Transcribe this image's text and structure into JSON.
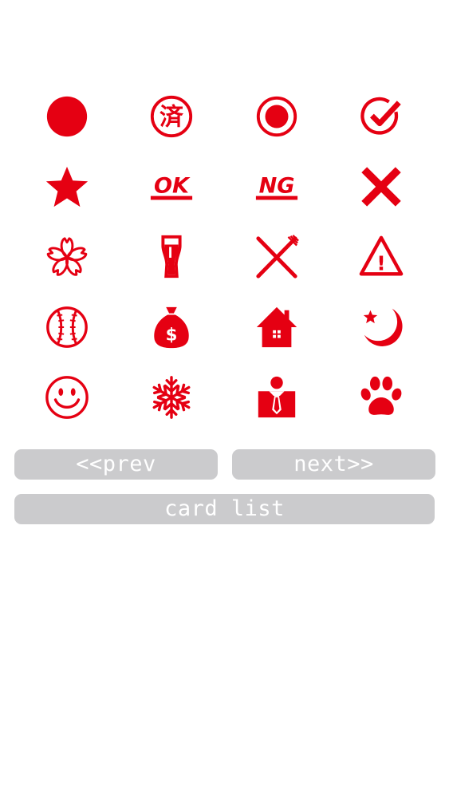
{
  "colors": {
    "stamp": "#e50012",
    "button_bg": "#cbcbcd",
    "button_text": "#ffffff"
  },
  "stamps": [
    "filled-circle",
    "sumi-kanji",
    "double-circle",
    "check-circle",
    "star",
    "ok",
    "ng",
    "cross",
    "sakura",
    "beer",
    "fork-knife",
    "warning",
    "baseball",
    "money-bag",
    "house",
    "moon-star",
    "smiley",
    "snowflake",
    "businessman",
    "paw"
  ],
  "stamp_text": {
    "sumi": "済",
    "ok": "OK",
    "ng": "NG",
    "money": "$",
    "warning": "!"
  },
  "nav": {
    "prev": "<<prev",
    "next": "next>>",
    "card_list": "card list"
  }
}
